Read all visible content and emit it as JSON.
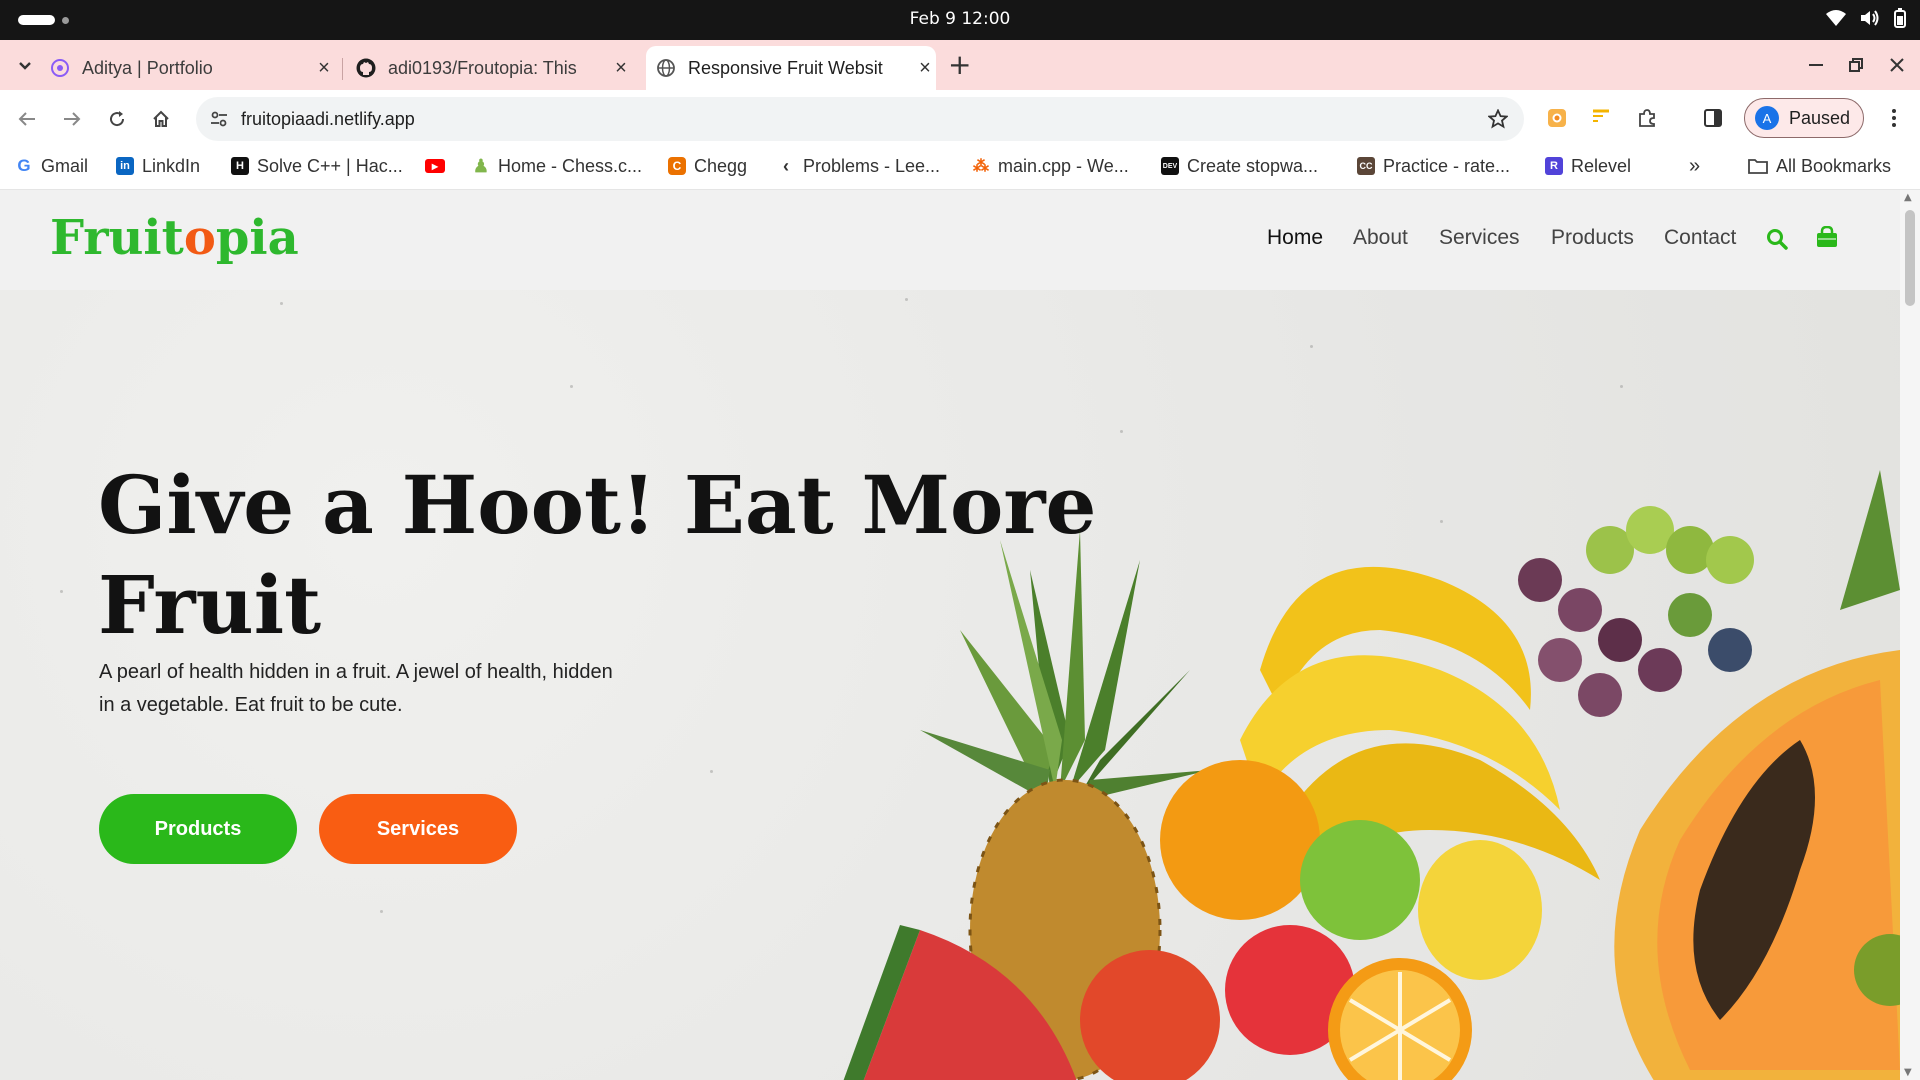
{
  "os": {
    "clock": "Feb 9  12:00"
  },
  "tabs": [
    {
      "title": "Aditya | Portfolio",
      "active": false
    },
    {
      "title": "adi0193/Froutopia: This",
      "active": false
    },
    {
      "title": "Responsive Fruit Websit",
      "active": true
    }
  ],
  "toolbar": {
    "url": "fruitopiaadi.netlify.app",
    "profile_initial": "A",
    "profile_status": "Paused"
  },
  "bookmarks": [
    {
      "label": "Gmail",
      "icon": "google-icon",
      "color": "#4285f4"
    },
    {
      "label": "LinkdIn",
      "icon": "linkedin-icon",
      "color": "#0a66c2"
    },
    {
      "label": "Solve C++ | Hac...",
      "icon": "hackerrank-icon",
      "color": "#111111"
    },
    {
      "label": "",
      "icon": "youtube-icon",
      "color": "#ff0000"
    },
    {
      "label": "Home - Chess.c...",
      "icon": "chess-icon",
      "color": "#81b64c"
    },
    {
      "label": "Chegg",
      "icon": "chegg-icon",
      "color": "#eb7100"
    },
    {
      "label": "Problems - Lee...",
      "icon": "leetcode-icon",
      "color": "#ffa116"
    },
    {
      "label": "main.cpp - We...",
      "icon": "replit-icon",
      "color": "#f26207"
    },
    {
      "label": "Create stopwa...",
      "icon": "dev-icon",
      "color": "#111111"
    },
    {
      "label": "Practice - rate...",
      "icon": "codechef-icon",
      "color": "#5b4638"
    },
    {
      "label": "Relevel",
      "icon": "relevel-icon",
      "color": "#5143d9"
    }
  ],
  "bookmarks_all": "All Bookmarks",
  "site": {
    "logo_a": "Fruit",
    "logo_b": "o",
    "logo_c": "pia",
    "nav": [
      "Home",
      "About",
      "Services",
      "Products",
      "Contact"
    ],
    "hero_title": "Give a Hoot! Eat More Fruit",
    "hero_desc": "A pearl of health hidden in a fruit. A jewel of health, hidden in a vegetable. Eat fruit to be cute.",
    "btn_products": "Products",
    "btn_services": "Services",
    "accent_green": "#2ab81a",
    "accent_orange": "#f95d12"
  }
}
